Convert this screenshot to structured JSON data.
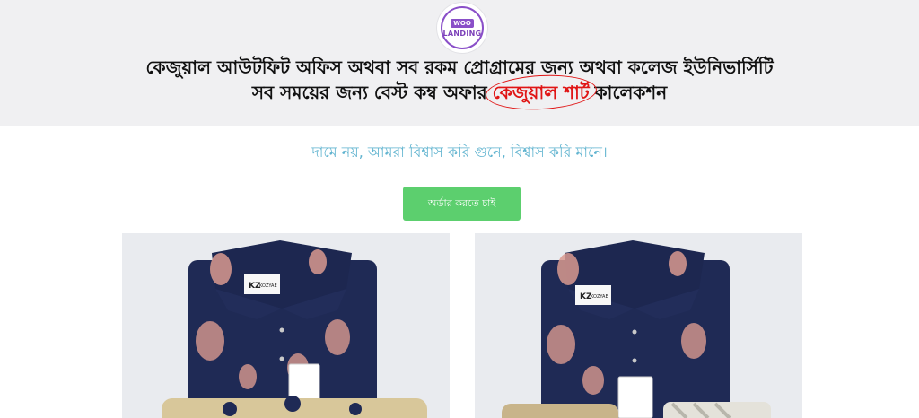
{
  "logo": {
    "badge": "WOO",
    "text": "LANDING"
  },
  "headline": {
    "line1": "কেজুয়াল আউটফিট অফিস অথবা সব রকম প্রোগ্রামের জন্য অথবা কলেজ ইউনিভার্সিটি",
    "line2_before": "সব সময়ের জন্য বেস্ট কম্ব অফার",
    "line2_highlight": "কেজুয়াল শার্ট",
    "line2_after": "কালেকশন"
  },
  "tagline": "দামে নয়, আমরা বিশ্বাস করি গুনে, বিশ্বাস করি মানে।",
  "order_button": {
    "label": "অর্ডার করতে চাই"
  },
  "products": [
    {
      "brand": "KOZYAE",
      "tag_mark": "KZ"
    },
    {
      "brand": "KOZYAE",
      "tag_mark": "KZ"
    }
  ],
  "colors": {
    "header_bg": "#f0f0f2",
    "accent_red": "#e01515",
    "tagline": "#5fb3cf",
    "button": "#5ccf6e",
    "shirt_navy": "#1f2a55",
    "shirt_print": "#d99a8f",
    "logo_purple": "#8a4fc8"
  }
}
